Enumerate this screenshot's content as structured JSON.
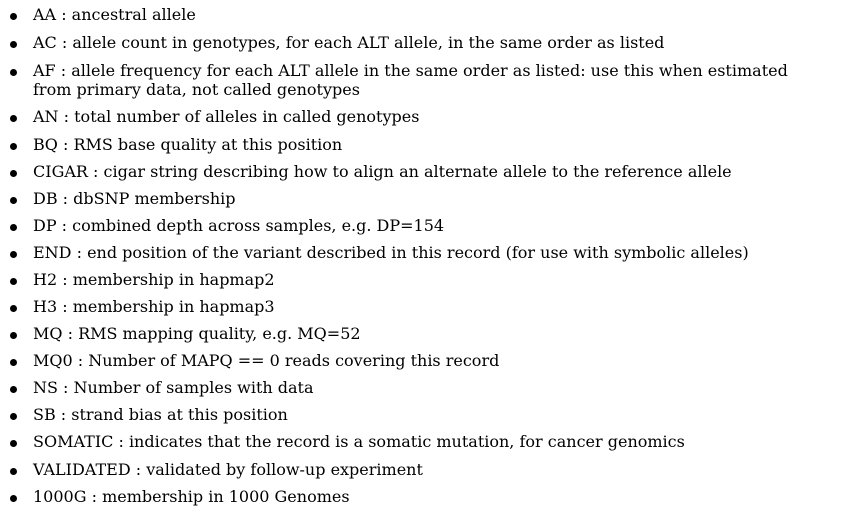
{
  "items": [
    {
      "key": "AA",
      "desc": "ancestral allele"
    },
    {
      "key": "AC",
      "desc": "allele count in genotypes, for each ALT allele, in the same order as listed"
    },
    {
      "key": "AF",
      "desc": "allele frequency for each ALT allele in the same order as listed: use this when estimated from primary data, not called genotypes"
    },
    {
      "key": "AN",
      "desc": "total number of alleles in called genotypes"
    },
    {
      "key": "BQ",
      "desc": "RMS base quality at this position"
    },
    {
      "key": "CIGAR",
      "desc": "cigar string describing how to align an alternate allele to the reference allele"
    },
    {
      "key": "DB",
      "desc": "dbSNP membership"
    },
    {
      "key": "DP",
      "desc": "combined depth across samples, e.g. DP=154"
    },
    {
      "key": "END",
      "desc": "end position of the variant described in this record (for use with symbolic alleles)"
    },
    {
      "key": "H2",
      "desc": "membership in hapmap2"
    },
    {
      "key": "H3",
      "desc": "membership in hapmap3"
    },
    {
      "key": "MQ",
      "desc": "RMS mapping quality, e.g. MQ=52"
    },
    {
      "key": "MQ0",
      "desc": "Number of MAPQ == 0 reads covering this record"
    },
    {
      "key": "NS",
      "desc": "Number of samples with data"
    },
    {
      "key": "SB",
      "desc": "strand bias at this position"
    },
    {
      "key": "SOMATIC",
      "desc": "indicates that the record is a somatic mutation, for cancer genomics"
    },
    {
      "key": "VALIDATED",
      "desc": "validated by follow-up experiment"
    },
    {
      "key": "1000G",
      "desc": "membership in 1000 Genomes"
    }
  ],
  "separator": " : "
}
